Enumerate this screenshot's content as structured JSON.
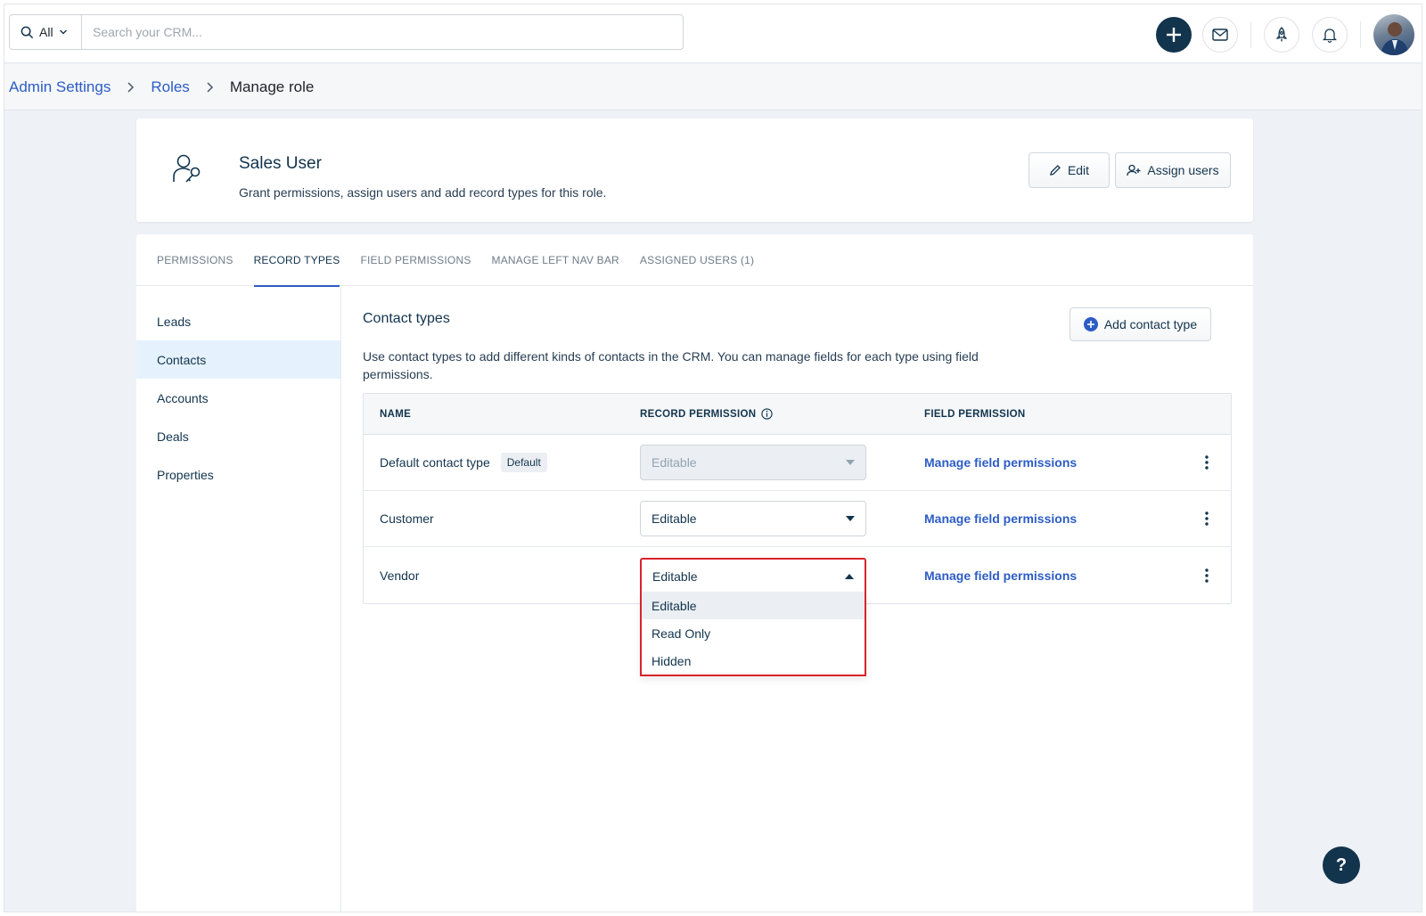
{
  "topbar": {
    "scope_label": "All",
    "search_placeholder": "Search your CRM..."
  },
  "breadcrumb": {
    "items": [
      "Admin Settings",
      "Roles"
    ],
    "current": "Manage role"
  },
  "role": {
    "title": "Sales User",
    "description": "Grant permissions, assign users and add record types for this role.",
    "edit_label": "Edit",
    "assign_label": "Assign users"
  },
  "tabs": [
    {
      "label": "PERMISSIONS",
      "active": false
    },
    {
      "label": "RECORD TYPES",
      "active": true
    },
    {
      "label": "FIELD PERMISSIONS",
      "active": false
    },
    {
      "label": "MANAGE LEFT NAV BAR",
      "active": false
    },
    {
      "label": "ASSIGNED USERS (1)",
      "active": false
    }
  ],
  "sidebar": {
    "items": [
      {
        "label": "Leads",
        "active": false
      },
      {
        "label": "Contacts",
        "active": true
      },
      {
        "label": "Accounts",
        "active": false
      },
      {
        "label": "Deals",
        "active": false
      },
      {
        "label": "Properties",
        "active": false
      }
    ]
  },
  "contact_types": {
    "title": "Contact types",
    "add_label": "Add contact type",
    "description": "Use contact types to add different kinds of contacts in the CRM. You can manage fields for each type using field permissions.",
    "columns": {
      "name": "NAME",
      "record_permission": "RECORD PERMISSION",
      "field_permission": "FIELD PERMISSION"
    },
    "rows": [
      {
        "name": "Default contact type",
        "badge": "Default",
        "permission": "Editable",
        "field_link": "Manage field permissions"
      },
      {
        "name": "Customer",
        "permission": "Editable",
        "field_link": "Manage field permissions"
      },
      {
        "name": "Vendor",
        "permission": "Editable",
        "field_link": "Manage field permissions"
      }
    ],
    "dropdown_options": [
      "Editable",
      "Read Only",
      "Hidden"
    ]
  },
  "help": {
    "label": "?"
  },
  "colors": {
    "accent": "#2c5cc5",
    "navy": "#12344d",
    "highlight": "#d9232b",
    "active_nav_bg": "#e5f2fd"
  }
}
